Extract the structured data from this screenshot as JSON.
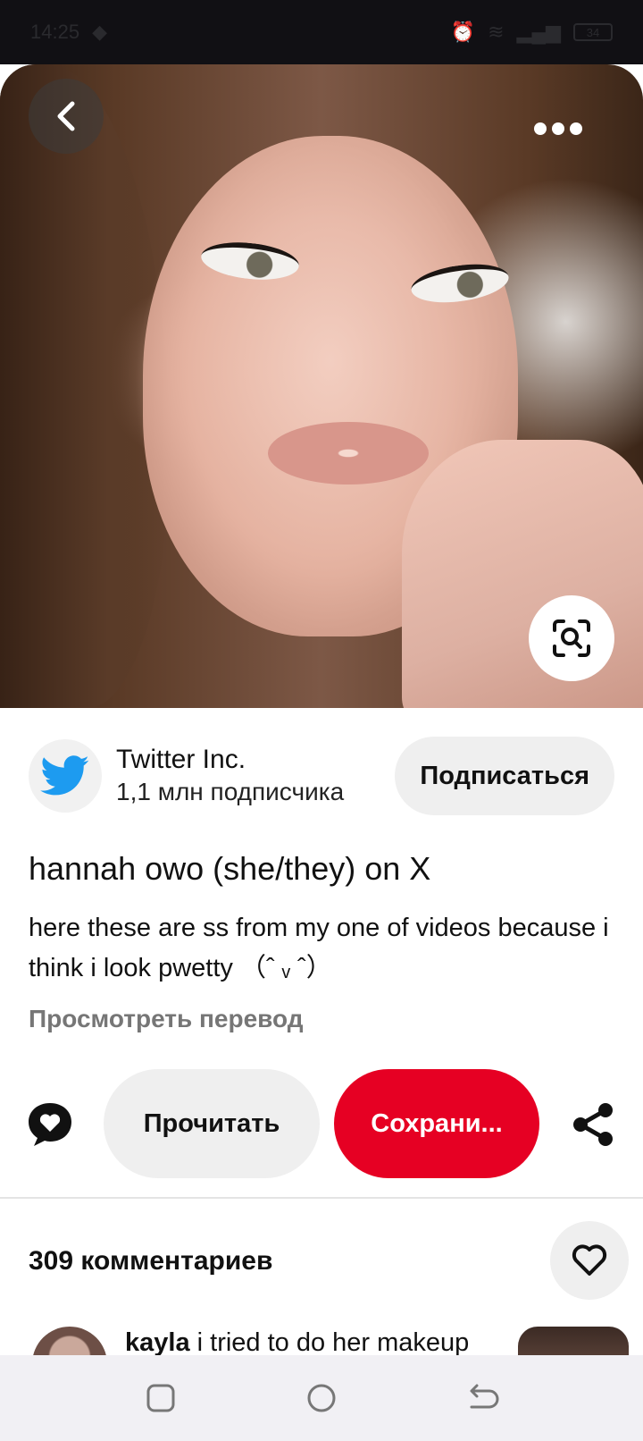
{
  "status_bar": {
    "time": "14:25",
    "battery": "34"
  },
  "pin": {
    "creator_name": "Twitter Inc.",
    "creator_followers": "1,1 млн подписчика",
    "follow_label": "Подписаться",
    "title": "hannah owo (she/they) on X",
    "description": "here these are ss from my one of videos because i think i look pwetty （ˆ ᵥ ˆ）",
    "translate_label": "Просмотреть перевод"
  },
  "actions": {
    "read_label": "Прочитать",
    "save_label": "Сохрани..."
  },
  "comments": {
    "count_label": "309 комментариев",
    "preview_author": "kayla",
    "preview_text": " i tried to do her makeup"
  },
  "colors": {
    "save_button": "#e60023",
    "twitter_blue": "#1d9bf0",
    "secondary_button": "#efefef"
  },
  "icons": [
    "back-arrow-icon",
    "more-dots-icon",
    "visual-search-icon",
    "twitter-bird-icon",
    "comment-heart-icon",
    "share-icon",
    "heart-outline-icon",
    "recents-icon",
    "home-circle-icon",
    "back-nav-icon"
  ]
}
